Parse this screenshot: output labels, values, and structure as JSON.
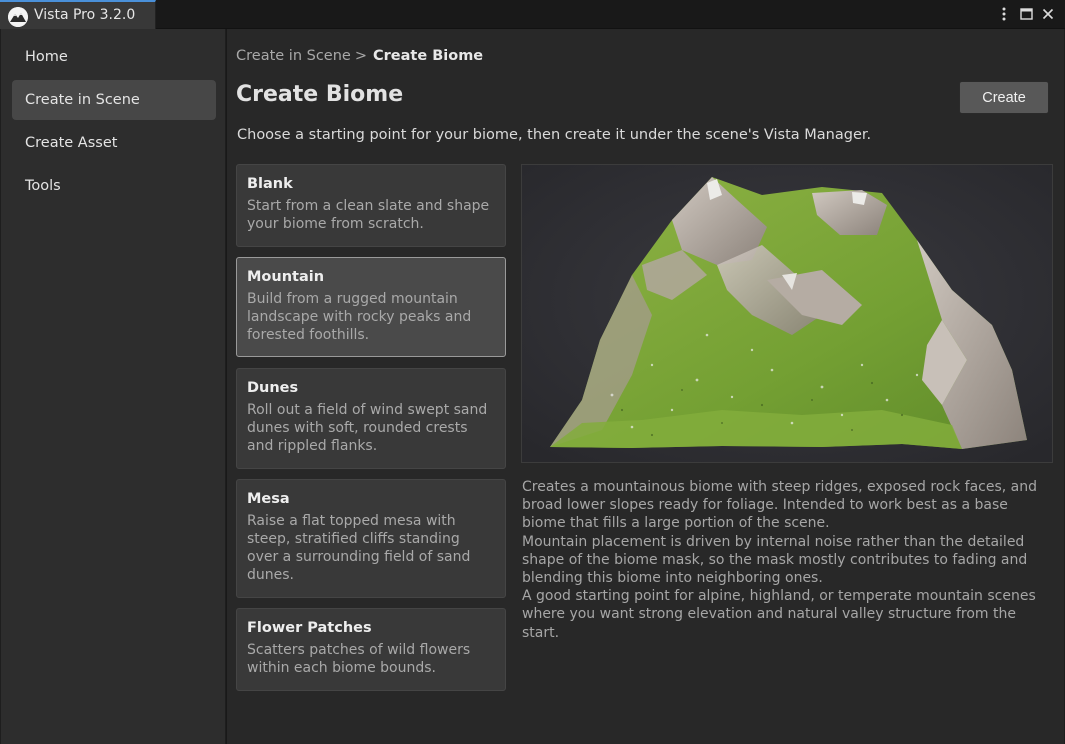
{
  "window": {
    "title": "Vista Pro 3.2.0",
    "controls": {
      "menu_icon": "kebab-menu-icon",
      "maximize_icon": "maximize-icon",
      "close_icon": "close-icon"
    }
  },
  "sidebar": {
    "items": [
      {
        "label": "Home",
        "active": false
      },
      {
        "label": "Create in Scene",
        "active": true
      },
      {
        "label": "Create Asset",
        "active": false
      },
      {
        "label": "Tools",
        "active": false
      }
    ]
  },
  "breadcrumb": {
    "parent": "Create in Scene",
    "separator": ">",
    "current": "Create Biome"
  },
  "page": {
    "title": "Create Biome",
    "create_label": "Create",
    "subtitle": "Choose a starting point for your biome, then create it under the scene's Vista Manager."
  },
  "templates": [
    {
      "title": "Blank",
      "description": "Start from a clean slate and shape your biome from scratch.",
      "selected": false
    },
    {
      "title": "Mountain",
      "description": "Build from a rugged mountain landscape with rocky peaks and forested foothills.",
      "selected": true
    },
    {
      "title": "Dunes",
      "description": "Roll out a field of wind swept sand dunes with soft, rounded crests and rippled flanks.",
      "selected": false
    },
    {
      "title": "Mesa",
      "description": "Raise a flat topped mesa with steep, stratified cliffs standing over a surrounding field of sand dunes.",
      "selected": false
    },
    {
      "title": "Flower Patches",
      "description": "Scatters patches of wild flowers within each biome bounds.",
      "selected": false
    }
  ],
  "preview": {
    "colors": {
      "background": "#2f2f33",
      "grass": "#7fa83a",
      "rock": "#a39a92",
      "snow": "#d8d4cf"
    }
  },
  "details": {
    "paragraphs": [
      "Creates a mountainous biome with steep ridges, exposed rock faces, and broad lower slopes ready for foliage. Intended to work best as a base biome that fills a large portion of the scene.",
      "Mountain placement is driven by internal noise rather than the detailed shape of the biome mask, so the mask mostly contributes to fading and blending this biome into neighboring ones.",
      "A good starting point for alpine, highland, or temperate mountain scenes where you want strong elevation and natural valley structure from the start."
    ]
  },
  "colors": {
    "accent": "#4a90d9",
    "selected_border": "#9a9a9a"
  }
}
